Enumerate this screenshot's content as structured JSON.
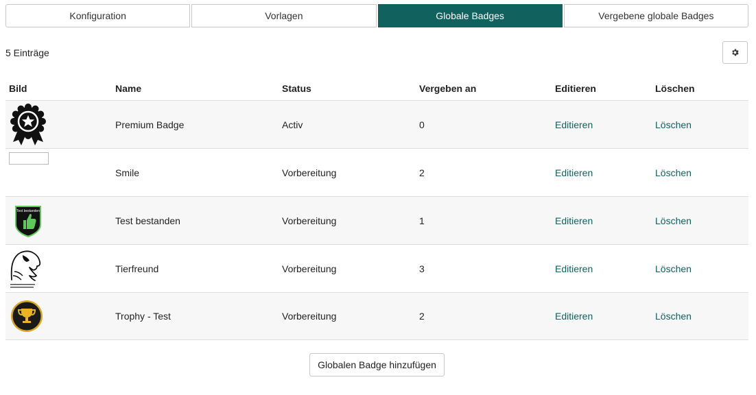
{
  "tabs": [
    {
      "label": "Konfiguration",
      "active": false
    },
    {
      "label": "Vorlagen",
      "active": false
    },
    {
      "label": "Globale Badges",
      "active": true
    },
    {
      "label": "Vergebene globale Badges",
      "active": false
    }
  ],
  "table": {
    "count_text": "5 Einträge",
    "headers": {
      "image": "Bild",
      "name": "Name",
      "status": "Status",
      "awarded": "Vergeben an",
      "edit": "Editieren",
      "delete": "Löschen"
    },
    "rows": [
      {
        "image_icon": "rosette-star-icon",
        "name": "Premium Badge",
        "status": "Activ",
        "awarded": "0",
        "edit": "Editieren",
        "delete": "Löschen"
      },
      {
        "image_icon": "broken-image-icon",
        "name": "Smile",
        "status": "Vorbereitung",
        "awarded": "2",
        "edit": "Editieren",
        "delete": "Löschen"
      },
      {
        "image_icon": "thumbs-up-shield-icon",
        "badge_text": "Test bestanden",
        "name": "Test bestanden",
        "status": "Vorbereitung",
        "awarded": "1",
        "edit": "Editieren",
        "delete": "Löschen"
      },
      {
        "image_icon": "eagle-head-icon",
        "name": "Tierfreund",
        "status": "Vorbereitung",
        "awarded": "3",
        "edit": "Editieren",
        "delete": "Löschen"
      },
      {
        "image_icon": "trophy-circle-icon",
        "name": "Trophy - Test",
        "status": "Vorbereitung",
        "awarded": "2",
        "edit": "Editieren",
        "delete": "Löschen"
      }
    ]
  },
  "settings_icon": "gear-icon",
  "add_button_label": "Globalen Badge hinzufügen",
  "colors": {
    "accent": "#11615f",
    "row_alt": "#f7f7f7",
    "border": "#c8c8c8"
  }
}
